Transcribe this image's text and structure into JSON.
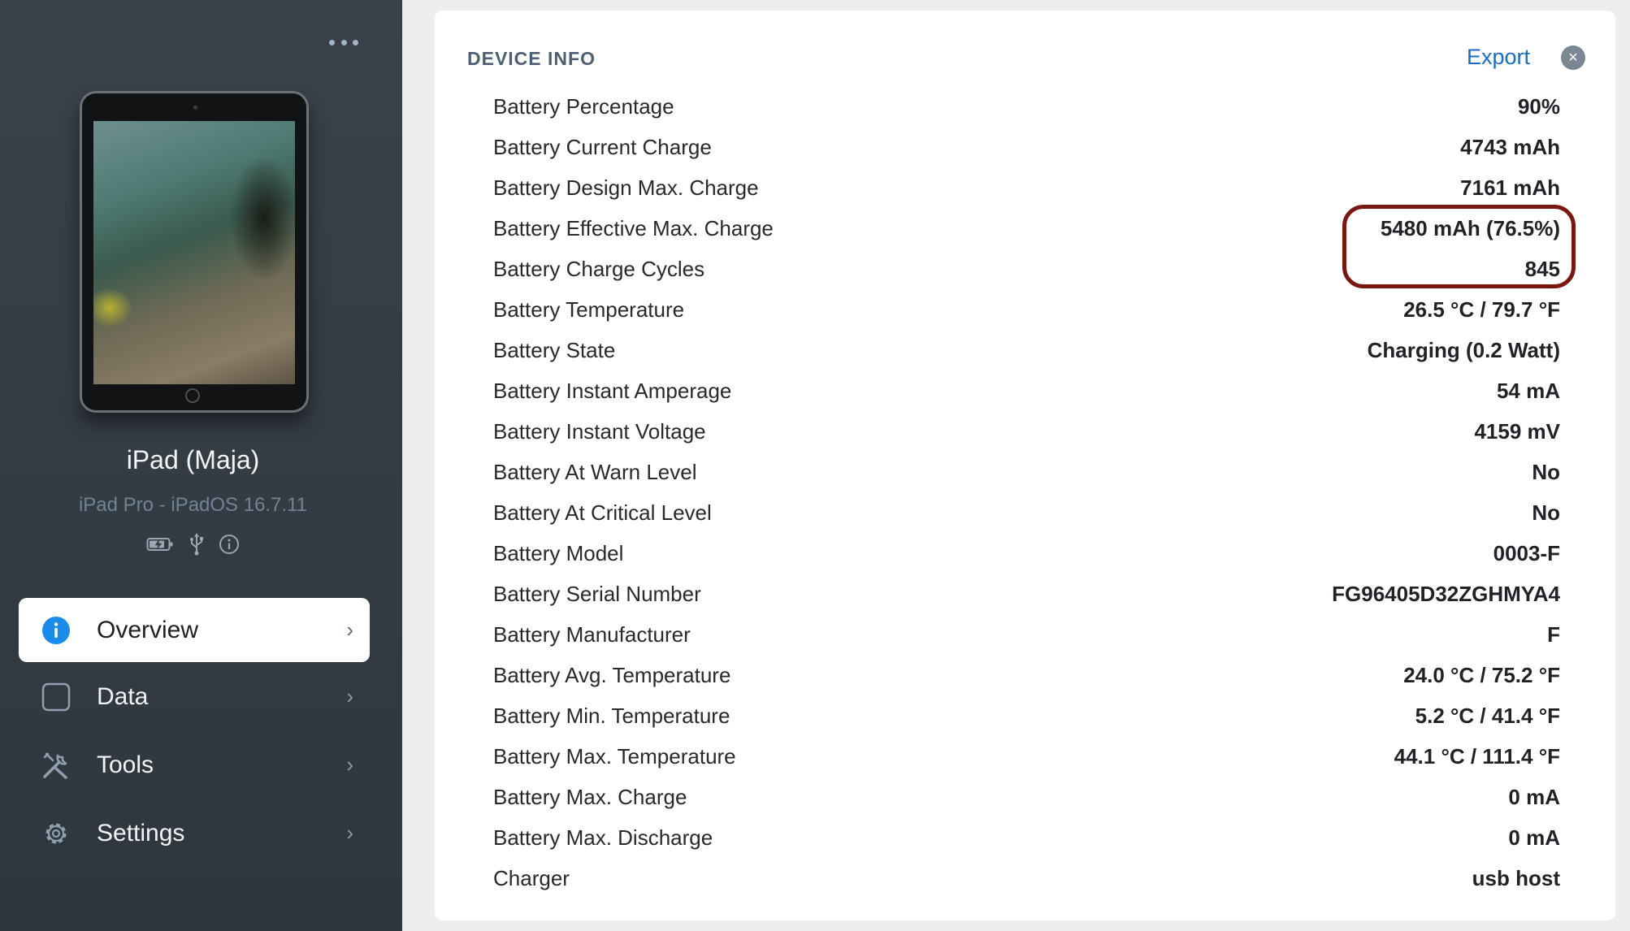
{
  "sidebar": {
    "device_name": "iPad (Maja)",
    "device_model": "iPad Pro - iPadOS 16.7.11",
    "status_icons": [
      "battery-charging-icon",
      "usb-icon",
      "info-icon"
    ],
    "nav": [
      {
        "label": "Overview",
        "icon": "info-circle-icon",
        "active": true
      },
      {
        "label": "Data",
        "icon": "square-icon",
        "active": false
      },
      {
        "label": "Tools",
        "icon": "tools-icon",
        "active": false
      },
      {
        "label": "Settings",
        "icon": "gear-icon",
        "active": false
      }
    ]
  },
  "panel": {
    "title": "DEVICE INFO",
    "export_label": "Export",
    "close_symbol": "×",
    "rows": [
      {
        "label": "Battery Percentage",
        "value": "90%"
      },
      {
        "label": "Battery Current Charge",
        "value": "4743 mAh"
      },
      {
        "label": "Battery Design Max. Charge",
        "value": "7161 mAh"
      },
      {
        "label": "Battery Effective Max. Charge",
        "value": "5480 mAh (76.5%)"
      },
      {
        "label": "Battery Charge Cycles",
        "value": "845"
      },
      {
        "label": "Battery Temperature",
        "value": "26.5 °C / 79.7 °F"
      },
      {
        "label": "Battery State",
        "value": "Charging (0.2 Watt)"
      },
      {
        "label": "Battery Instant Amperage",
        "value": "54 mA"
      },
      {
        "label": "Battery Instant Voltage",
        "value": "4159 mV"
      },
      {
        "label": "Battery At Warn Level",
        "value": "No"
      },
      {
        "label": "Battery At Critical Level",
        "value": "No"
      },
      {
        "label": "Battery Model",
        "value": "0003-F"
      },
      {
        "label": "Battery Serial Number",
        "value": "FG96405D32ZGHMYA4"
      },
      {
        "label": "Battery Manufacturer",
        "value": "F"
      },
      {
        "label": "Battery Avg. Temperature",
        "value": "24.0 °C / 75.2 °F"
      },
      {
        "label": "Battery Min. Temperature",
        "value": "5.2 °C / 41.4 °F"
      },
      {
        "label": "Battery Max. Temperature",
        "value": "44.1 °C / 111.4 °F"
      },
      {
        "label": "Battery Max. Charge",
        "value": "0 mA"
      },
      {
        "label": "Battery Max. Discharge",
        "value": "0 mA"
      },
      {
        "label": "Charger",
        "value": "usb host"
      }
    ]
  },
  "colors": {
    "sidebar_bg": "#353b43",
    "accent": "#1a6cc4",
    "highlight_border": "#7a1710",
    "active_nav_icon": "#1a8be8"
  }
}
